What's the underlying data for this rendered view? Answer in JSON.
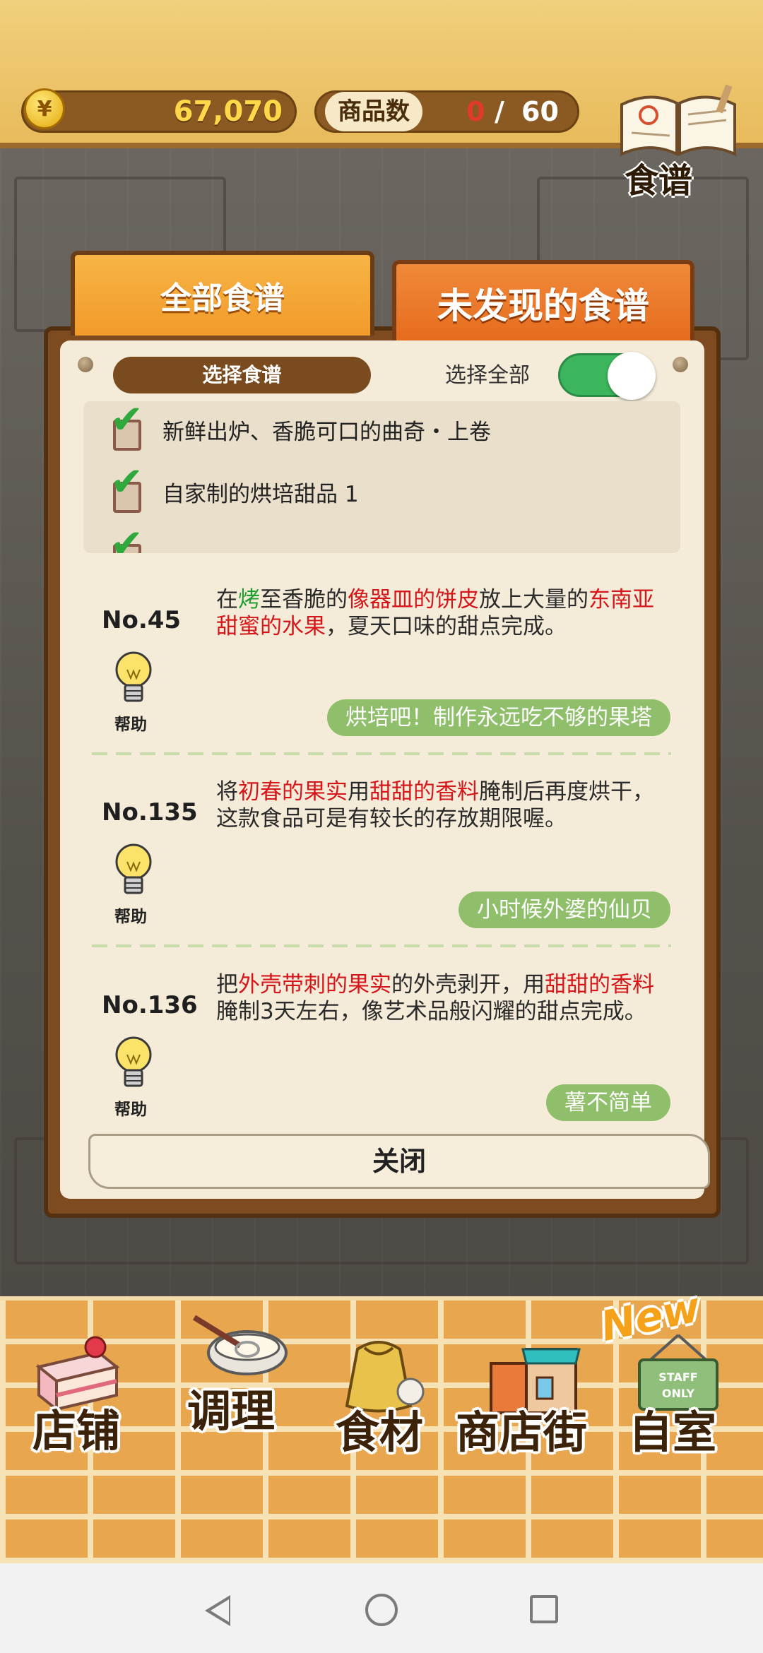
{
  "header": {
    "coin_symbol": "¥",
    "coins": "67,070",
    "product_count_label": "商品数",
    "product_count_current": "0",
    "product_count_separator": "/",
    "product_count_total": "60",
    "recipe_book_label": "食谱"
  },
  "tabs": {
    "all_recipes": "全部食谱",
    "undiscovered_recipes": "未发现的食谱"
  },
  "filter": {
    "select_recipe_label": "选择食谱",
    "select_all_label": "选择全部",
    "select_all_on": true,
    "items": [
      {
        "label": "新鲜出炉、香脆可口的曲奇・上卷",
        "checked": true
      },
      {
        "label": "自家制的烘培甜品 1",
        "checked": true
      },
      {
        "label": "",
        "checked": true
      }
    ]
  },
  "entries": [
    {
      "number": "No.45",
      "hint_label": "帮助",
      "desc": [
        {
          "t": "在",
          "c": ""
        },
        {
          "t": "烤",
          "c": "g"
        },
        {
          "t": "至香脆的",
          "c": ""
        },
        {
          "t": "像器皿的饼皮",
          "c": "r"
        },
        {
          "t": "放上大量的",
          "c": ""
        },
        {
          "t": "东南亚甜蜜的水果",
          "c": "r"
        },
        {
          "t": "，夏天口味的甜点完成。",
          "c": ""
        }
      ],
      "name": "烘培吧！制作永远吃不够的果塔"
    },
    {
      "number": "No.135",
      "hint_label": "帮助",
      "desc": [
        {
          "t": "将",
          "c": ""
        },
        {
          "t": "初春的果实",
          "c": "r"
        },
        {
          "t": "用",
          "c": ""
        },
        {
          "t": "甜甜的香料",
          "c": "r"
        },
        {
          "t": "腌制后再度烘干，这款食品可是有较长的存放期限喔。",
          "c": ""
        }
      ],
      "name": "小时候外婆的仙贝"
    },
    {
      "number": "No.136",
      "hint_label": "帮助",
      "desc": [
        {
          "t": "把",
          "c": ""
        },
        {
          "t": "外壳带刺的果实",
          "c": "r"
        },
        {
          "t": "的外壳剥开，用",
          "c": ""
        },
        {
          "t": "甜甜的香料",
          "c": "r"
        },
        {
          "t": "腌制3天左右，像艺术品般闪耀的甜点完成。",
          "c": ""
        }
      ],
      "name": "薯不简单"
    }
  ],
  "close_label": "关闭",
  "nav": {
    "shop": "店铺",
    "cooking": "调理",
    "ingredients": "食材",
    "street": "商店街",
    "room": "自室",
    "new_badge": "New",
    "staff_sign": "STAFF ONLY"
  },
  "colors": {
    "accent_orange": "#e66b1e",
    "highlight_red": "#d5161b",
    "highlight_green": "#1f9d2f",
    "toggle_green": "#3cb55c",
    "name_pill_green": "#8fbf6a"
  },
  "icons": {
    "coin": "yen-coin-icon",
    "recipe_book": "open-book-icon",
    "hint": "lightbulb-icon",
    "check": "checkmark-icon",
    "shop": "cake-icon",
    "cooking": "whisk-bowl-icon",
    "ingredients": "flour-sack-icon",
    "street": "storefront-icon",
    "room": "staff-door-icon"
  }
}
